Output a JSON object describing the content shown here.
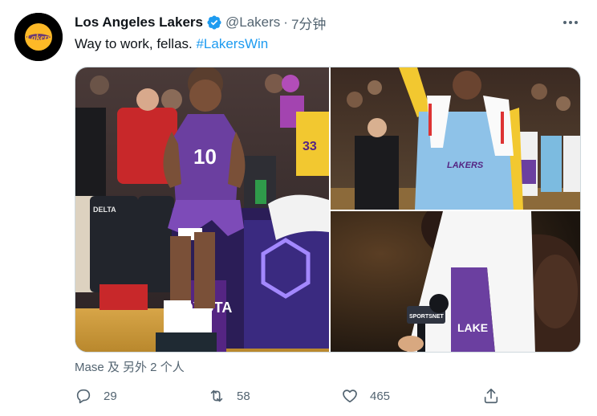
{
  "author": {
    "name": "Los Angeles Lakers",
    "handle": "@Lakers",
    "time": "7分钟",
    "avatar_text": "Lakers",
    "avatar_icon": "lakers-logo-icon",
    "verified_icon": "verified-badge-icon"
  },
  "tweet": {
    "text": "Way to work, fellas. ",
    "hashtag": "#LakersWin"
  },
  "media": {
    "photos": [
      {
        "name": "photo-player-courtside"
      },
      {
        "name": "photo-player-towel-crowd"
      },
      {
        "name": "photo-player-interview"
      }
    ],
    "photo_texts": {
      "jersey_number": "10",
      "sponsor_delta": "DELTA",
      "sponsor_toyota": "TOYOTA",
      "mic_label": "SPORTSNET",
      "shirt_text": "LAKERS",
      "jersey_text": "LAKE",
      "bg_number": "33"
    }
  },
  "tagged": "Mase 及 另外 2 个人",
  "actions": {
    "replies": "29",
    "retweets": "58",
    "likes": "465"
  },
  "colors": {
    "accent": "#1d9bf0",
    "lakers_purple": "#552583",
    "lakers_gold": "#fdb927",
    "muted": "#536471"
  }
}
